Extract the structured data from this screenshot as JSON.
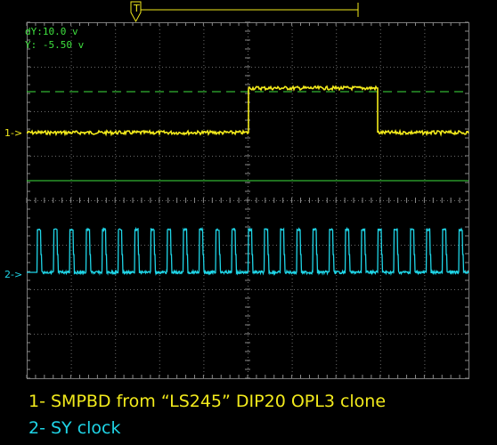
{
  "cursor_readout": {
    "dy": "dY:10.0 v",
    "y": "Y:  -5.50 v"
  },
  "trigger_marker": "T",
  "channels": [
    {
      "marker": "1->",
      "name": "SMPBD from “LS245” DIP20 OPL3 clone",
      "color": "#f2ea1c"
    },
    {
      "marker": "2->",
      "name": "SY clock",
      "color": "#1fd4e6"
    }
  ],
  "captions": {
    "line1": "1- SMPBD from “LS245” DIP20 OPL3 clone",
    "line2": "2- SY clock"
  },
  "colors": {
    "background": "#000000",
    "grid": "#7a7a7a",
    "cursor": "#3ee03e",
    "ch1": "#f2ea1c",
    "ch2": "#1fd4e6"
  }
}
